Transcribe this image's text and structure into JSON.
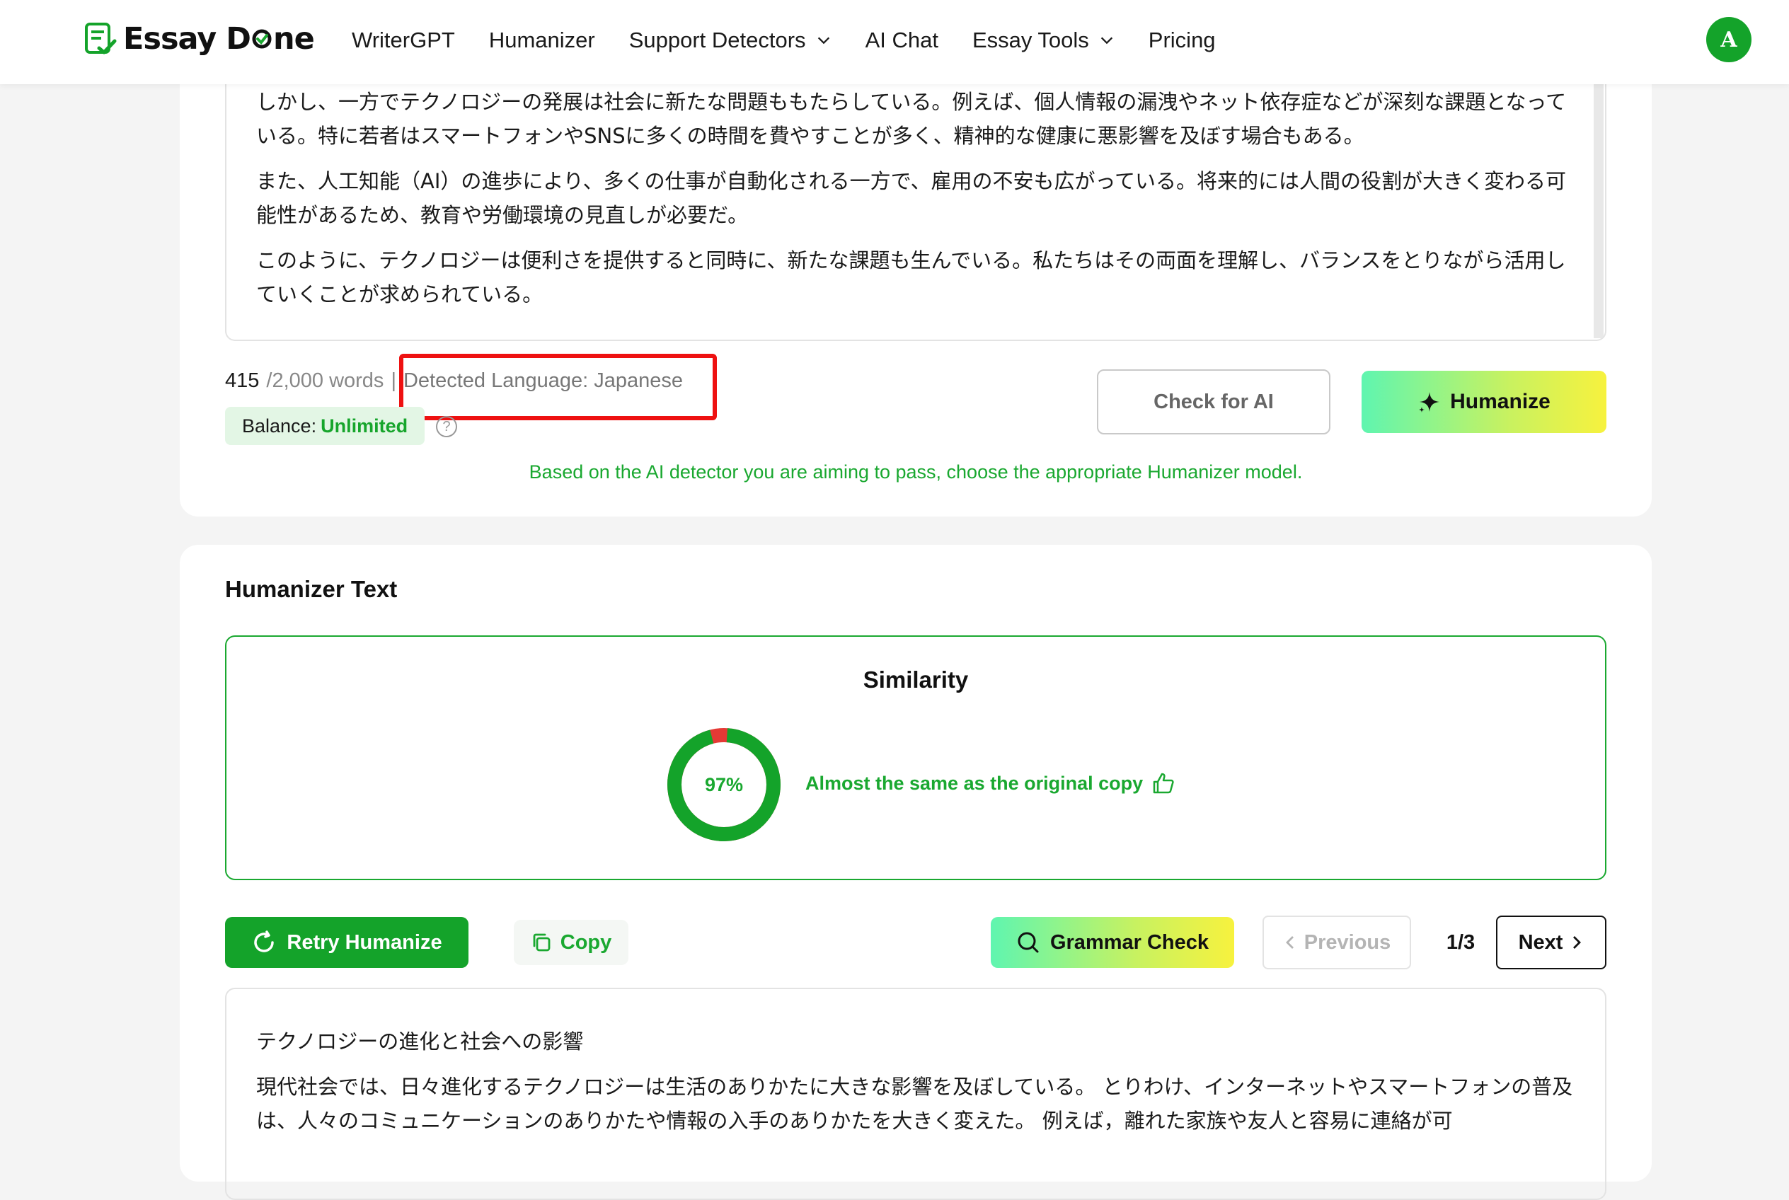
{
  "header": {
    "logo_text_a": "Essay D",
    "logo_text_b": "ne",
    "nav": [
      {
        "label": "WriterGPT"
      },
      {
        "label": "Humanizer"
      },
      {
        "label": "Support Detectors"
      },
      {
        "label": "AI Chat"
      },
      {
        "label": "Essay Tools"
      },
      {
        "label": "Pricing"
      }
    ],
    "avatar_initial": "A"
  },
  "input": {
    "paragraphs": [
      "しかし、一方でテクノロジーの発展は社会に新たな問題ももたらしている。例えば、個人情報の漏洩やネット依存症などが深刻な課題となっている。特に若者はスマートフォンやSNSに多くの時間を費やすことが多く、精神的な健康に悪影響を及ぼす場合もある。",
      "また、人工知能（AI）の進歩により、多くの仕事が自動化される一方で、雇用の不安も広がっている。将来的には人間の役割が大きく変わる可能性があるため、教育や労働環境の見直しが必要だ。",
      "このように、テクノロジーは便利さを提供すると同時に、新たな課題も生んでいる。私たちはその両面を理解し、バランスをとりながら活用していくことが求められている。"
    ],
    "word_count": "415",
    "word_limit": "/2,000 words",
    "separator": "|",
    "detected_language": "Detected Language: Japanese",
    "balance_label": "Balance:",
    "balance_value": "Unlimited",
    "help_icon_glyph": "?",
    "check_button": "Check for AI",
    "humanize_button": "Humanize",
    "hint": "Based on the AI detector you are aiming to pass, choose the appropriate Humanizer model."
  },
  "output": {
    "section_title": "Humanizer Text",
    "similarity_title": "Similarity",
    "similarity_value": 97,
    "similarity_label": "97%",
    "similarity_note": "Almost the same as the original copy",
    "retry_button": "Retry Humanize",
    "copy_button": "Copy",
    "grammar_button": "Grammar Check",
    "prev_button": "Previous",
    "page_indicator": "1/3",
    "next_button": "Next",
    "title_line": "テクノロジーの進化と社会への影響",
    "body": "現代社会では、日々進化するテクノロジーは生活のありかたに大きな影響を及ぼしている。 とりわけ、インターネットやスマートフォンの普及は、人々のコミュニケーションのありかたや情報の入手のありかたを大きく変えた。 例えば，離れた家族や友人と容易に連絡が可"
  },
  "colors": {
    "brand_green": "#14a32a",
    "highlight_red": "#ee1111",
    "donut_red": "#e53935"
  }
}
